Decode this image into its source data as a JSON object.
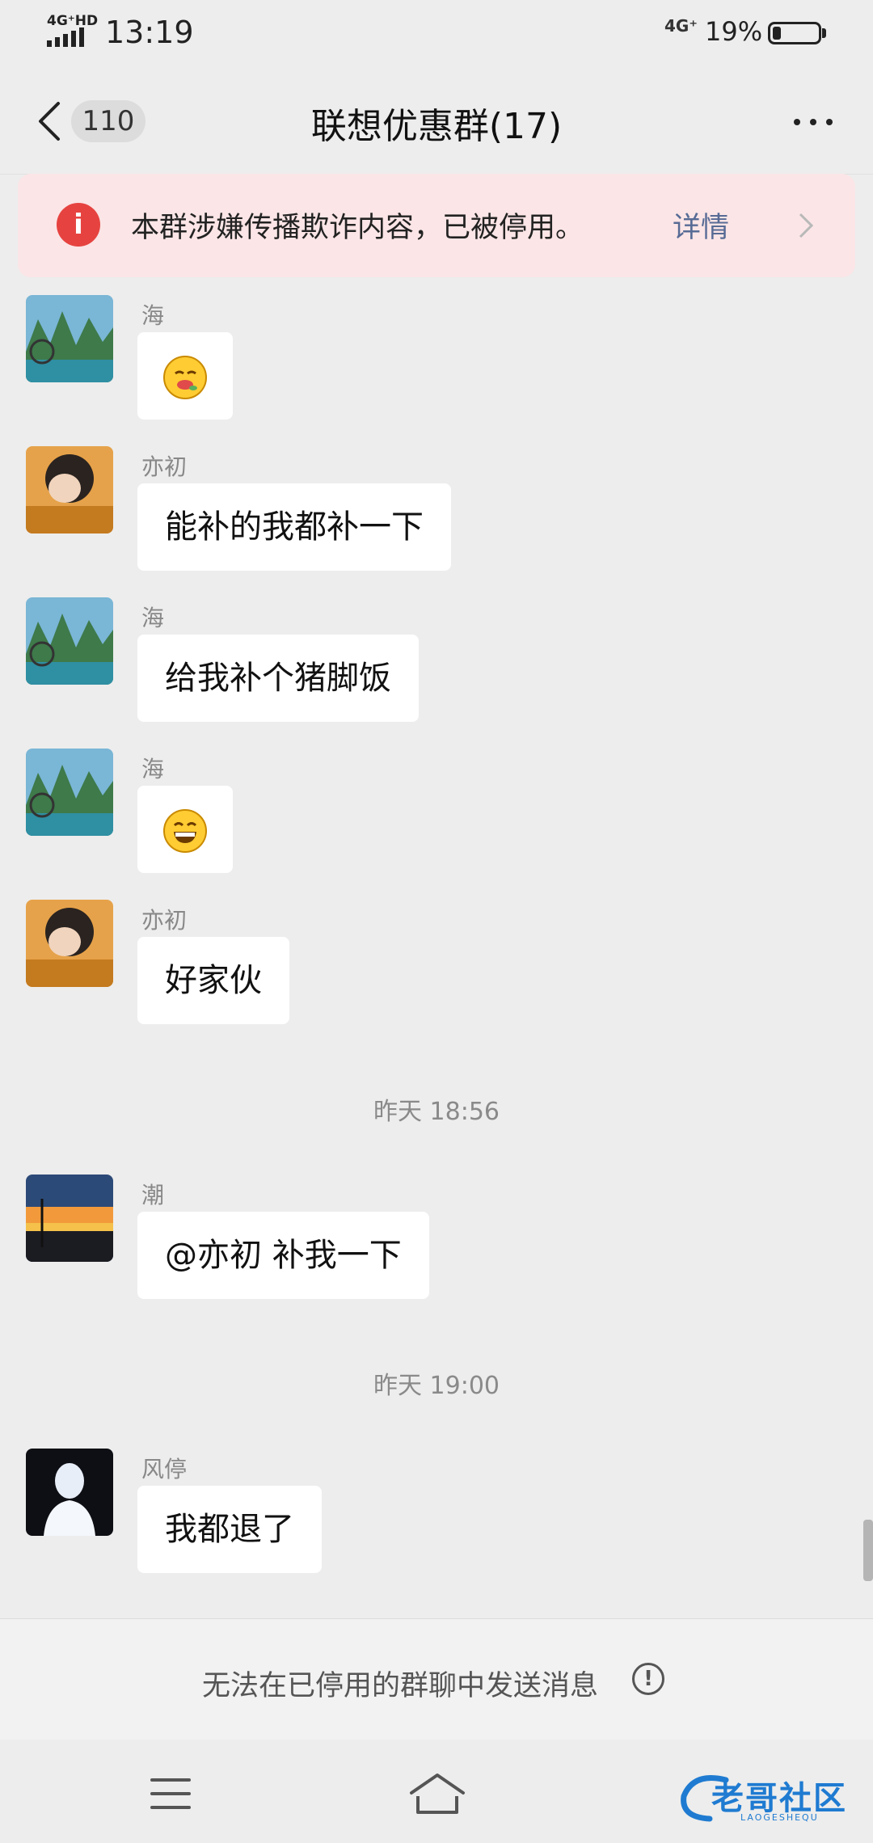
{
  "status_bar": {
    "signal_label": "4G⁺HD",
    "time": "13:19",
    "network": "4G⁺",
    "battery_percent": "19%",
    "battery_level": 0.19
  },
  "nav": {
    "unread_count": "110",
    "title": "联想优惠群(17)",
    "more_icon": "more-dots-icon"
  },
  "banner": {
    "text": "本群涉嫌传播欺诈内容，已被停用。",
    "link": "详情",
    "color": "#e64340"
  },
  "messages": [
    {
      "sender": "海",
      "text": "",
      "emoji": "smiling-face-emoji"
    },
    {
      "sender": "亦初",
      "text": "能补的我都补一下"
    },
    {
      "sender": "海",
      "text": "给我补个猪脚饭"
    },
    {
      "sender": "海",
      "text": "",
      "emoji": "grinning-face-emoji"
    },
    {
      "sender": "亦初",
      "text": "好家伙"
    },
    {
      "sender": "潮",
      "text": "@亦初  补我一下"
    },
    {
      "sender": "风停",
      "text": "我都退了"
    }
  ],
  "timestamps": [
    "昨天 18:56",
    "昨天 19:00"
  ],
  "input_area": {
    "disabled_text": "无法在已停用的群聊中发送消息"
  },
  "watermark": {
    "text": "老哥社区",
    "sub": "LAOGESHEQU"
  }
}
